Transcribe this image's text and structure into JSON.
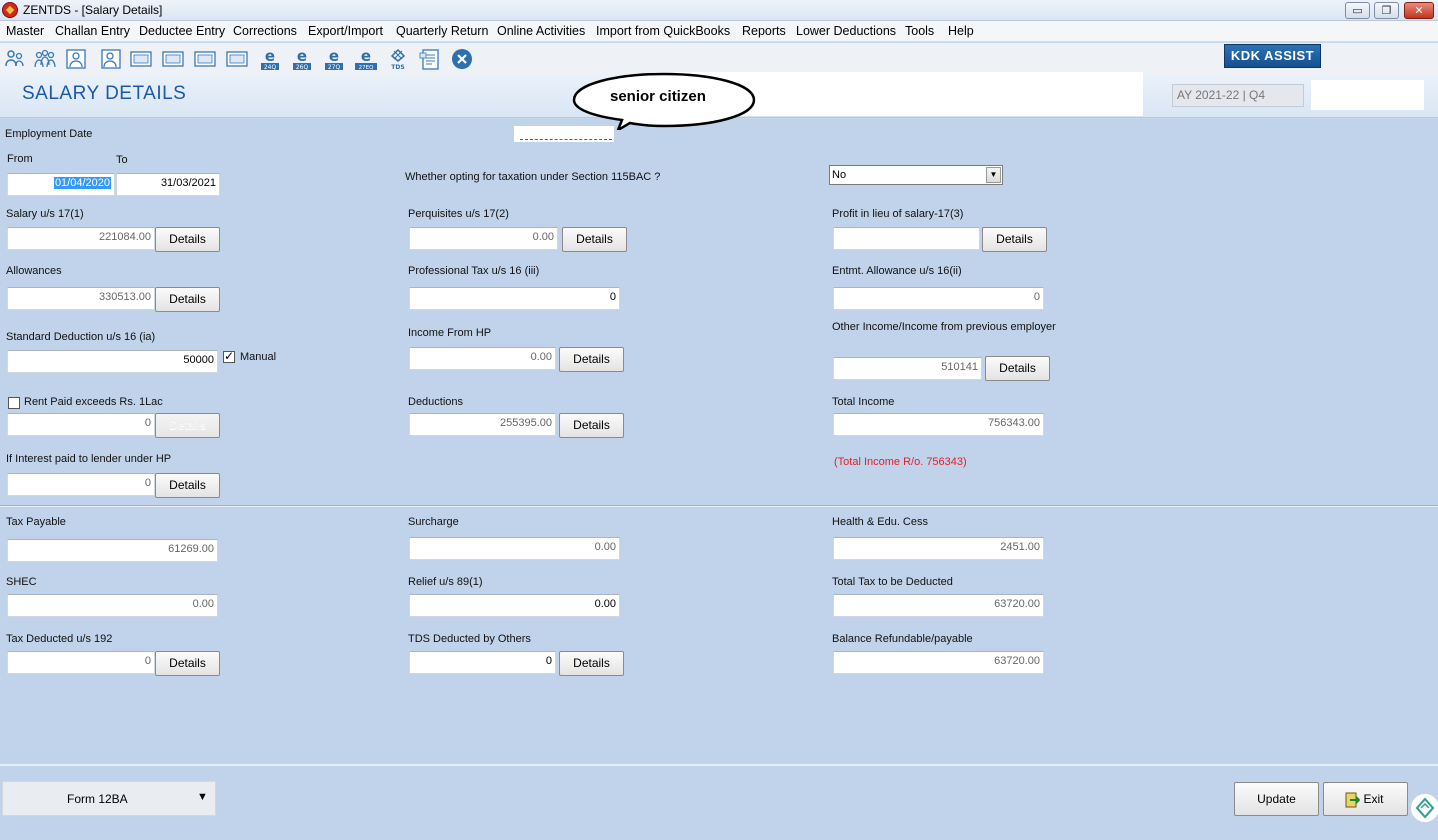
{
  "window": {
    "title": "ZENTDS - [Salary Details]",
    "min_label": "▭",
    "max_label": "❐",
    "close_label": "✕"
  },
  "menu": [
    "Master",
    "Challan Entry",
    "Deductee Entry",
    "Corrections",
    "Export/Import",
    "Quarterly Return",
    "Online Activities",
    "Import from QuickBooks",
    "Reports",
    "Lower Deductions",
    "Tools",
    "Help"
  ],
  "toolbar": {
    "icons": [
      "users-icon",
      "group-icon",
      "person-icon",
      "person-add-icon",
      "form-26q-icon",
      "form-26q2-icon",
      "form-27q-icon",
      "form-27eq-icon",
      "e-24q-icon",
      "e-26q-icon",
      "e-27q-icon",
      "e-27eq-icon",
      "tds-icon",
      "document-icon",
      "close-circle-icon"
    ],
    "e_labels": [
      "24Q",
      "26Q",
      "27Q",
      "27EQ"
    ],
    "tds_label": "TDS",
    "kdk_assist": "KDK ASSIST"
  },
  "header": {
    "page_title": "SALARY DETAILS",
    "callout": "senior citizen",
    "assessment_year": "AY 2021-22 | Q4"
  },
  "employment": {
    "label": "Employment Date",
    "from_label": "From",
    "to_label": "To",
    "from_value": "01/04/2020",
    "to_value": "31/03/2021"
  },
  "taxation_option": {
    "question": "Whether opting for taxation under Section 115BAC ?",
    "value": "No"
  },
  "fields": {
    "salary_17_1": {
      "label": "Salary u/s 17(1)",
      "value": "221084.00"
    },
    "perquisites": {
      "label": "Perquisites u/s 17(2)",
      "value": "0.00"
    },
    "profit_lieu": {
      "label": "Profit in lieu of salary-17(3)",
      "value": ""
    },
    "allowances": {
      "label": "Allowances",
      "value": "330513.00"
    },
    "professional_tax": {
      "label": "Professional Tax u/s 16 (iii)",
      "value": "0"
    },
    "entmt_allowance": {
      "label": "Entmt. Allowance u/s 16(ii)",
      "value": "0"
    },
    "standard_deduction": {
      "label": "Standard Deduction u/s 16 (ia)",
      "value": "50000",
      "manual_label": "Manual",
      "manual_checked": true
    },
    "income_hp": {
      "label": "Income From HP",
      "value": "0.00"
    },
    "other_income": {
      "label": "Other Income/Income from previous employer",
      "value": "510141"
    },
    "rent_paid": {
      "label": "Rent Paid exceeds Rs. 1Lac",
      "value": "0",
      "checked": false
    },
    "deductions": {
      "label": "Deductions",
      "value": "255395.00"
    },
    "total_income": {
      "label": "Total Income",
      "value": "756343.00",
      "rounded": "(Total Income R/o. 756343)"
    },
    "interest_lender": {
      "label": "If Interest paid to lender under HP",
      "value": "0"
    },
    "tax_payable": {
      "label": "Tax Payable",
      "value": "61269.00"
    },
    "surcharge": {
      "label": "Surcharge",
      "value": "0.00"
    },
    "cess": {
      "label": "Health & Edu. Cess",
      "value": "2451.00"
    },
    "shec": {
      "label": "SHEC",
      "value": "0.00"
    },
    "relief_89": {
      "label": "Relief u/s 89(1)",
      "value": "0.00"
    },
    "total_tax": {
      "label": "Total Tax to be Deducted",
      "value": "63720.00"
    },
    "tax_deducted_192": {
      "label": "Tax Deducted u/s 192",
      "value": "0"
    },
    "tds_others": {
      "label": "TDS Deducted by Others",
      "value": "0"
    },
    "balance": {
      "label": "Balance Refundable/payable",
      "value": "63720.00"
    }
  },
  "buttons": {
    "details": "Details",
    "update": "Update",
    "exit": "Exit"
  },
  "footer": {
    "form_select": "Form 12BA",
    "form_arrow": "▼"
  },
  "colors": {
    "panel_bg": "#c0d3ea",
    "title_blue": "#1c5aa5",
    "kdk_blue": "#1f5f9f",
    "warning_red": "#e0202a"
  }
}
